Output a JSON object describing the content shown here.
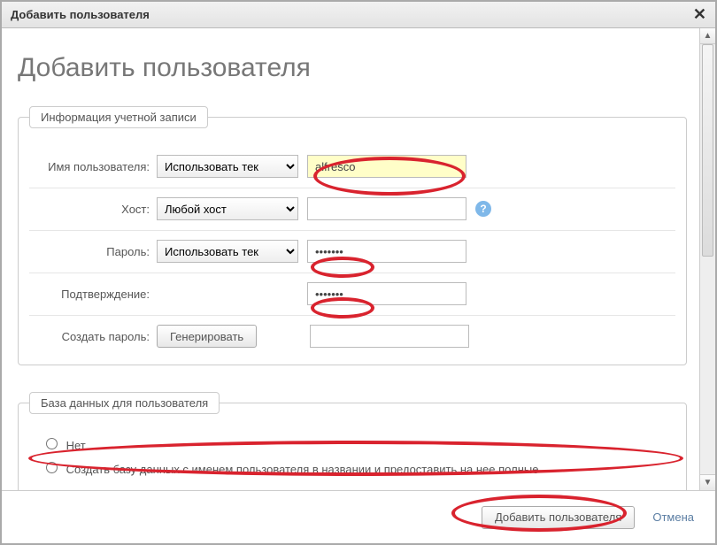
{
  "titlebar": {
    "title": "Добавить пользователя"
  },
  "heading": "Добавить пользователя",
  "section1": {
    "legend": "Информация учетной записи",
    "username_label": "Имя пользователя:",
    "username_select": "Использовать тек",
    "username_value": "alfresco",
    "host_label": "Хост:",
    "host_select": "Любой хост",
    "host_value": "",
    "password_label": "Пароль:",
    "password_select": "Использовать тек",
    "password_value": "•••••••",
    "confirm_label": "Подтверждение:",
    "confirm_value": "•••••••",
    "generate_label": "Создать пароль:",
    "generate_button": "Генерировать",
    "generate_value": ""
  },
  "section2": {
    "legend": "База данных для пользователя",
    "opt_none": "Нет",
    "opt_create": "Создать базу данных с именем пользователя в названии и предоставить на нее полные"
  },
  "footer": {
    "submit": "Добавить пользователя",
    "cancel": "Отмена"
  }
}
